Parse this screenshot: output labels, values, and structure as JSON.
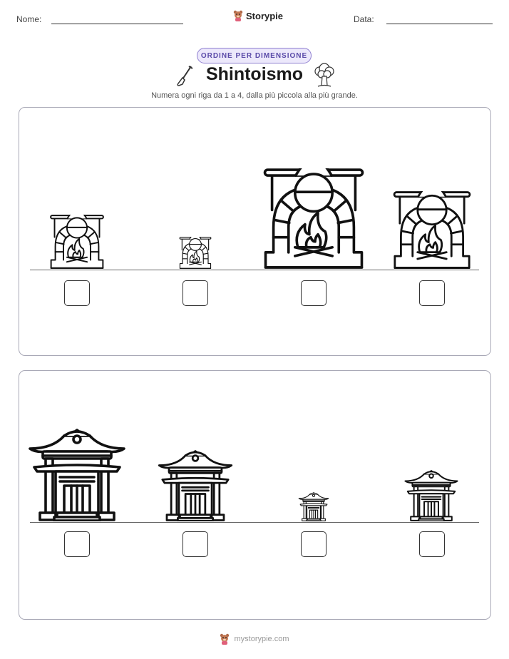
{
  "header": {
    "name_label": "Nome:",
    "date_label": "Data:",
    "brand": "Storypie"
  },
  "badge": "ORDINE PER DIMENSIONE",
  "title": "Shintoismo",
  "instructions": "Numera ogni riga da 1 a 4, dalla più piccola alla più grande.",
  "rows": [
    {
      "item": "fireplace-icon",
      "sizes": [
        1,
        0.6,
        1.8,
        1.4
      ]
    },
    {
      "item": "shrine-icon",
      "sizes": [
        1.85,
        1.4,
        0.55,
        1
      ]
    }
  ],
  "icons": {
    "left": "shovel-icon",
    "right": "sacred-tree-icon"
  },
  "footer": "mystorypie.com"
}
